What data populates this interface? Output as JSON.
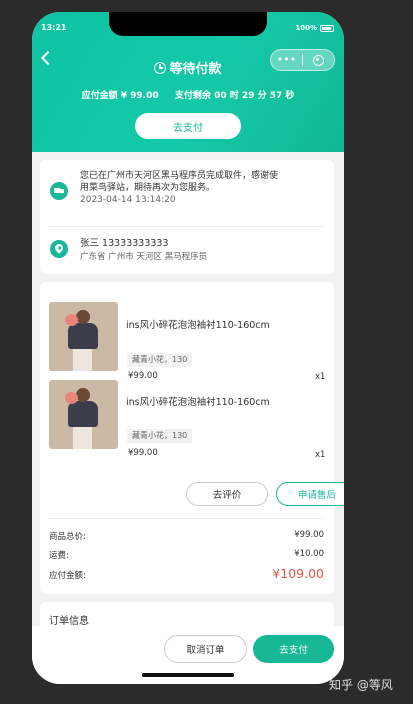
{
  "status_bar": {
    "time": "13:21",
    "battery": "100%"
  },
  "header": {
    "title": "等待付款",
    "amount_label": "应付金额",
    "amount_value": "¥ 99.00",
    "remaining_label": "支付剩余",
    "remaining_h": "00",
    "remaining_h_unit": "时",
    "remaining_m": "29",
    "remaining_m_unit": "分",
    "remaining_s": "57",
    "remaining_s_unit": "秒",
    "pay_button": "去支付"
  },
  "logistics": {
    "message_line1": "您已在广州市天河区黑马程序员完成取件，感谢使",
    "message_line2": "用菜鸟驿站，期待再次为您服务。",
    "time": "2023-04-14 13:14:20"
  },
  "address": {
    "name_phone": "张三 13333333333",
    "detail": "广东省 广州市 天河区 黑马程序员"
  },
  "products": [
    {
      "name": "ins风小碎花泡泡袖衬110-160cm",
      "spec": "藏青小花，130",
      "price": "¥99.00",
      "qty": "x1"
    },
    {
      "name": "ins风小碎花泡泡袖衬110-160cm",
      "spec": "藏青小花，130",
      "price": "¥99.00",
      "qty": "x1"
    }
  ],
  "order_actions": {
    "review": "去评价",
    "after_sale": "申请售后"
  },
  "summary": {
    "goods_total_label": "商品总价:",
    "goods_total": "¥99.00",
    "shipping_label": "运费:",
    "shipping": "¥10.00",
    "payable_label": "应付金额:",
    "payable": "¥109.00"
  },
  "order_info": {
    "title": "订单信息"
  },
  "bottom_bar": {
    "cancel": "取消订单",
    "pay": "去支付"
  },
  "watermark": "知乎 @等风",
  "colors": {
    "accent": "#18b897",
    "price_red": "#e4554a"
  }
}
